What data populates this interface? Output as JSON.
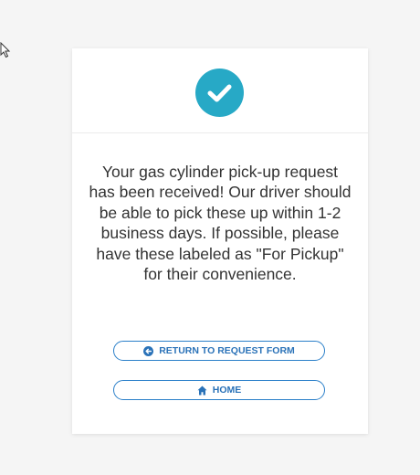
{
  "confirmation": {
    "message": "Your gas cylinder pick-up request has been received! Our driver should be able to pick these up within 1-2 business days. If possible, please have these labeled as \"For Pickup\" for their convenience.",
    "status_icon": "checkmark-circle-icon"
  },
  "actions": {
    "return_label": "RETURN TO REQUEST FORM",
    "return_icon": "arrow-circle-left-icon",
    "home_label": "HOME",
    "home_icon": "home-icon"
  },
  "colors": {
    "accent": "#27a9c6",
    "button_text": "#2a72b8",
    "button_border": "#2a7fc9",
    "background": "#f5f5f5"
  }
}
